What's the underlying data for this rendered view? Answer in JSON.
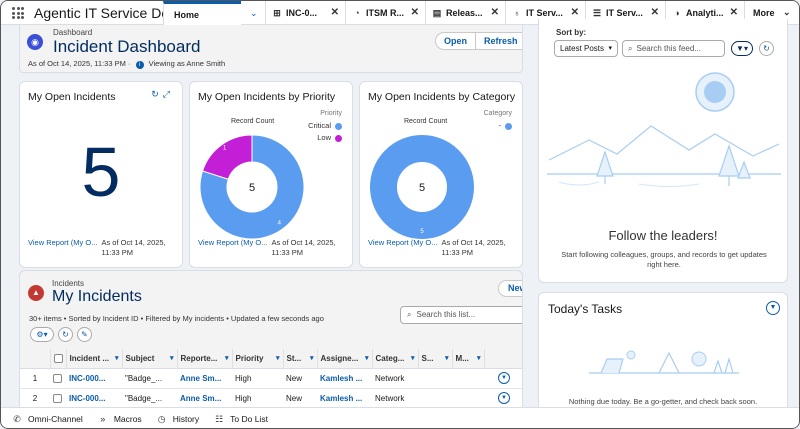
{
  "app": {
    "title": "Agentic IT Service Desk"
  },
  "tabs": [
    {
      "label": "Home",
      "icon": "",
      "active": true
    },
    {
      "label": "INC-0...",
      "icon": "incident-icon"
    },
    {
      "label": "ITSM R...",
      "icon": "report-icon"
    },
    {
      "label": "Releas...",
      "icon": "release-icon"
    },
    {
      "label": "IT Serv...",
      "icon": "lightbulb-icon"
    },
    {
      "label": "IT Serv...",
      "icon": "list-icon"
    },
    {
      "label": "Analyti...",
      "icon": "analytics-icon"
    }
  ],
  "more_label": "More",
  "dashboard": {
    "small_label": "Dashboard",
    "title": "Incident Dashboard",
    "as_of": "As of Oct 14, 2025, 11:33 PM ·",
    "viewing_as": "Viewing as Anne Smith",
    "open_label": "Open",
    "refresh_label": "Refresh"
  },
  "widgets": [
    {
      "title": "My Open Incidents",
      "value": "5",
      "report_link": "View Report (My O...",
      "as_of": "As of Oct 14, 2025, 11:33 PM"
    },
    {
      "title": "My Open Incidents by Priority",
      "report_link": "View Report (My O...",
      "as_of": "As of Oct 14, 2025, 11:33 PM"
    },
    {
      "title": "My Open Incidents by Category",
      "report_link": "View Report (My O...",
      "as_of": "As of Oct 14, 2025, 11:33 PM"
    }
  ],
  "chart_data": [
    {
      "type": "pie",
      "title": "My Open Incidents by Priority",
      "center_label": "Record Count",
      "total": 5,
      "legend_title": "Priority",
      "legend_position": "top-right",
      "slices": [
        {
          "name": "Critical",
          "value": 4,
          "color": "#5a9cf0"
        },
        {
          "name": "Low",
          "value": 1,
          "color": "#c21fd6"
        }
      ]
    },
    {
      "type": "pie",
      "title": "My Open Incidents by Category",
      "center_label": "Record Count",
      "total": 5,
      "legend_title": "Category",
      "legend_position": "top-right",
      "slices": [
        {
          "name": "-",
          "value": 5,
          "color": "#5a9cf0"
        }
      ]
    }
  ],
  "incidents": {
    "small_label": "Incidents",
    "title": "My Incidents",
    "meta": "30+ items • Sorted by Incident ID • Filtered by My incidents • Updated a few seconds ago",
    "new_label": "New",
    "search_placeholder": "Search this list...",
    "columns": [
      "Incident ...",
      "Subject",
      "Reporte...",
      "Priority",
      "St...",
      "Assigne...",
      "Categ...",
      "S...",
      "M..."
    ],
    "rows": [
      {
        "num": "1",
        "incident": "INC-000...",
        "subject": "\"Badge_...",
        "reporter": "Anne Sm...",
        "priority": "High",
        "status": "New",
        "assignee": "Kamlesh ...",
        "category": "Network"
      },
      {
        "num": "2",
        "incident": "INC-000...",
        "subject": "\"Badge_...",
        "reporter": "Anne Sm...",
        "priority": "High",
        "status": "New",
        "assignee": "Kamlesh ...",
        "category": "Network"
      }
    ]
  },
  "feed": {
    "sort_label": "Sort by:",
    "sort_value": "Latest Posts",
    "search_placeholder": "Search this feed...",
    "empty_title": "Follow the leaders!",
    "empty_sub": "Start following colleagues, groups, and records to get updates right here."
  },
  "tasks": {
    "title": "Today's Tasks",
    "empty": "Nothing due today. Be a go-getter, and check back soon."
  },
  "utility_bar": [
    {
      "label": "Omni-Channel",
      "icon": "phone-icon"
    },
    {
      "label": "Macros",
      "icon": "macros-icon"
    },
    {
      "label": "History",
      "icon": "history-icon"
    },
    {
      "label": "To Do List",
      "icon": "todo-icon"
    }
  ]
}
